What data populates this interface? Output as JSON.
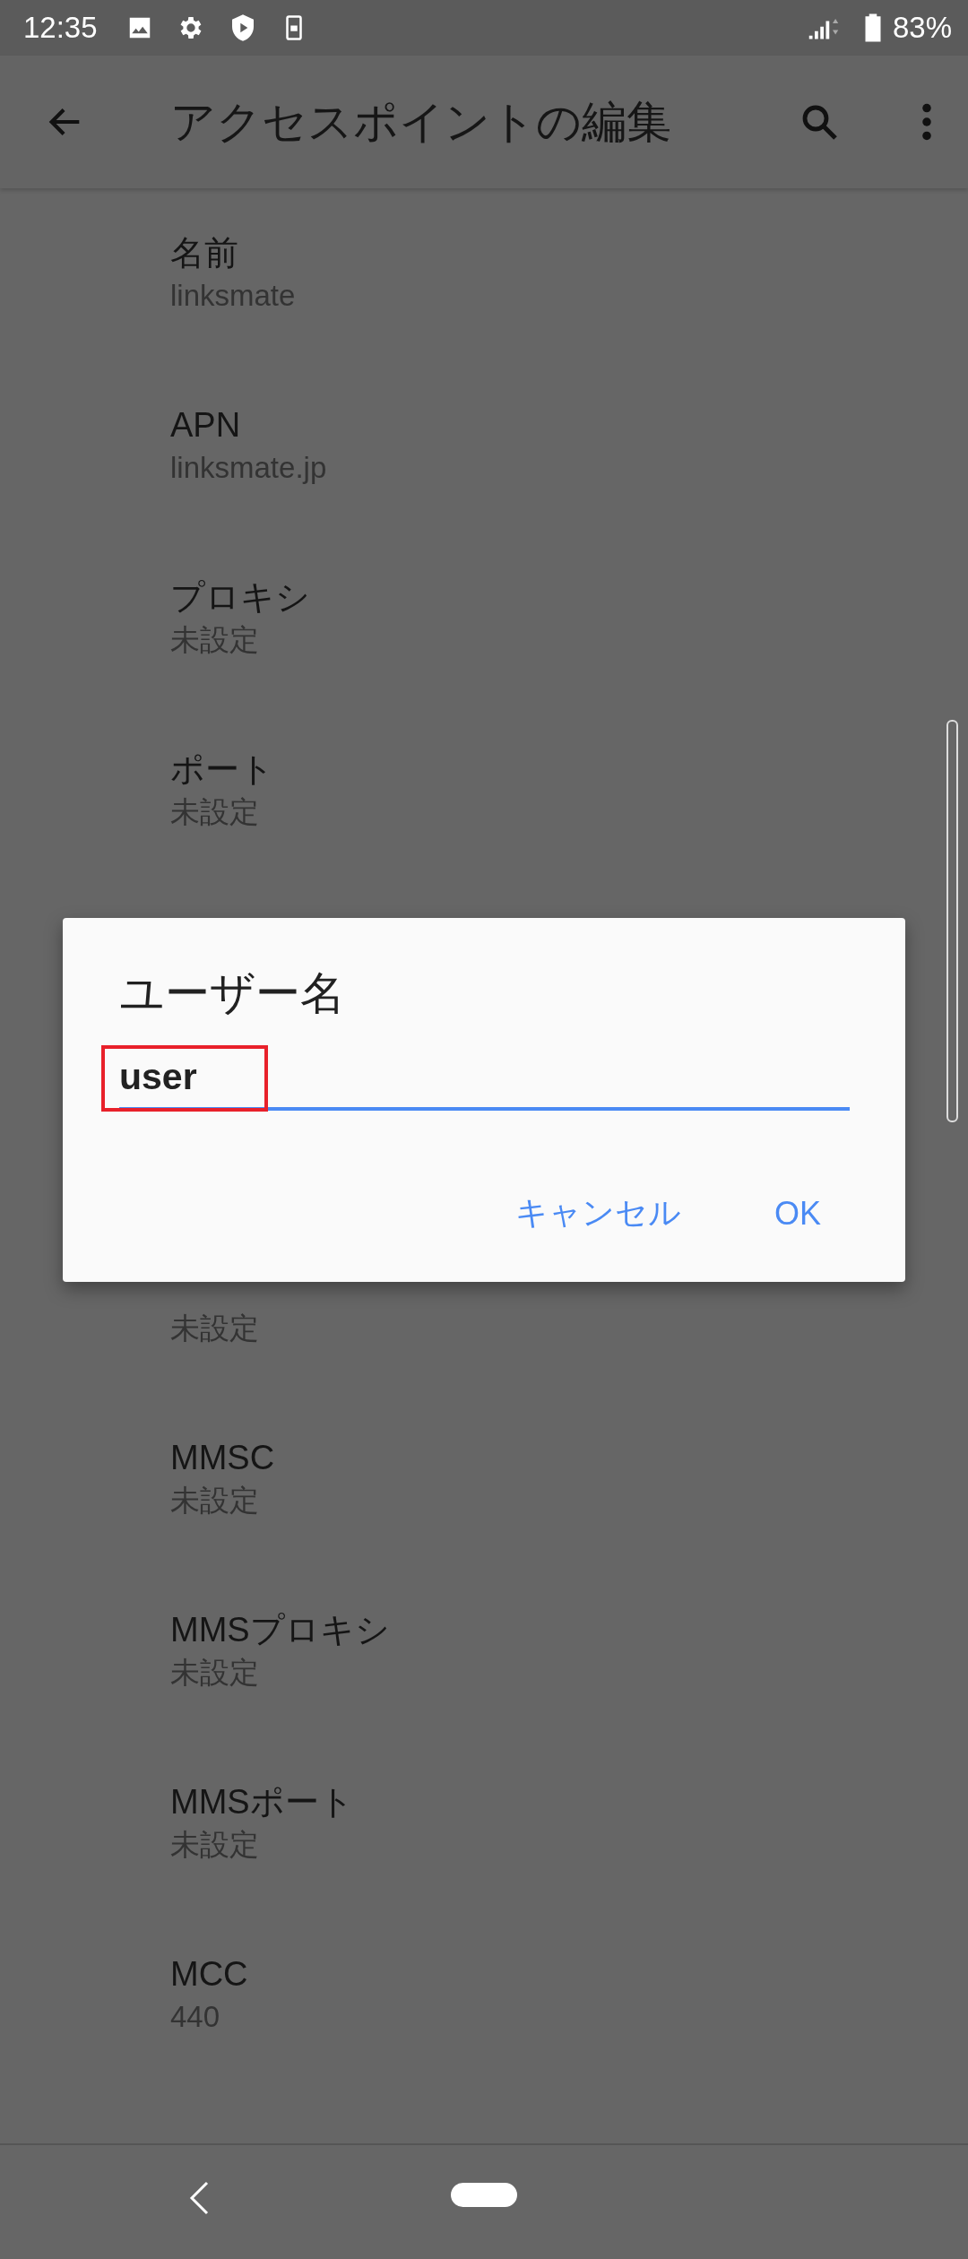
{
  "status_bar": {
    "time": "12:35",
    "battery": "83%"
  },
  "app_bar": {
    "title": "アクセスポイントの編集"
  },
  "settings_top": [
    {
      "title": "名前",
      "value": "linksmate"
    },
    {
      "title": "APN",
      "value": "linksmate.jp"
    },
    {
      "title": "プロキシ",
      "value": "未設定"
    },
    {
      "title": "ポート",
      "value": "未設定"
    }
  ],
  "settings_bottom": [
    {
      "value": "未設定"
    },
    {
      "title": "MMSC",
      "value": "未設定"
    },
    {
      "title": "MMSプロキシ",
      "value": "未設定"
    },
    {
      "title": "MMSポート",
      "value": "未設定"
    },
    {
      "title": "MCC",
      "value": "440"
    }
  ],
  "dialog": {
    "title": "ユーザー名",
    "field": {
      "value": "user",
      "focused": true,
      "highlighted": true
    },
    "buttons": [
      "キャンセル",
      "OK"
    ]
  }
}
